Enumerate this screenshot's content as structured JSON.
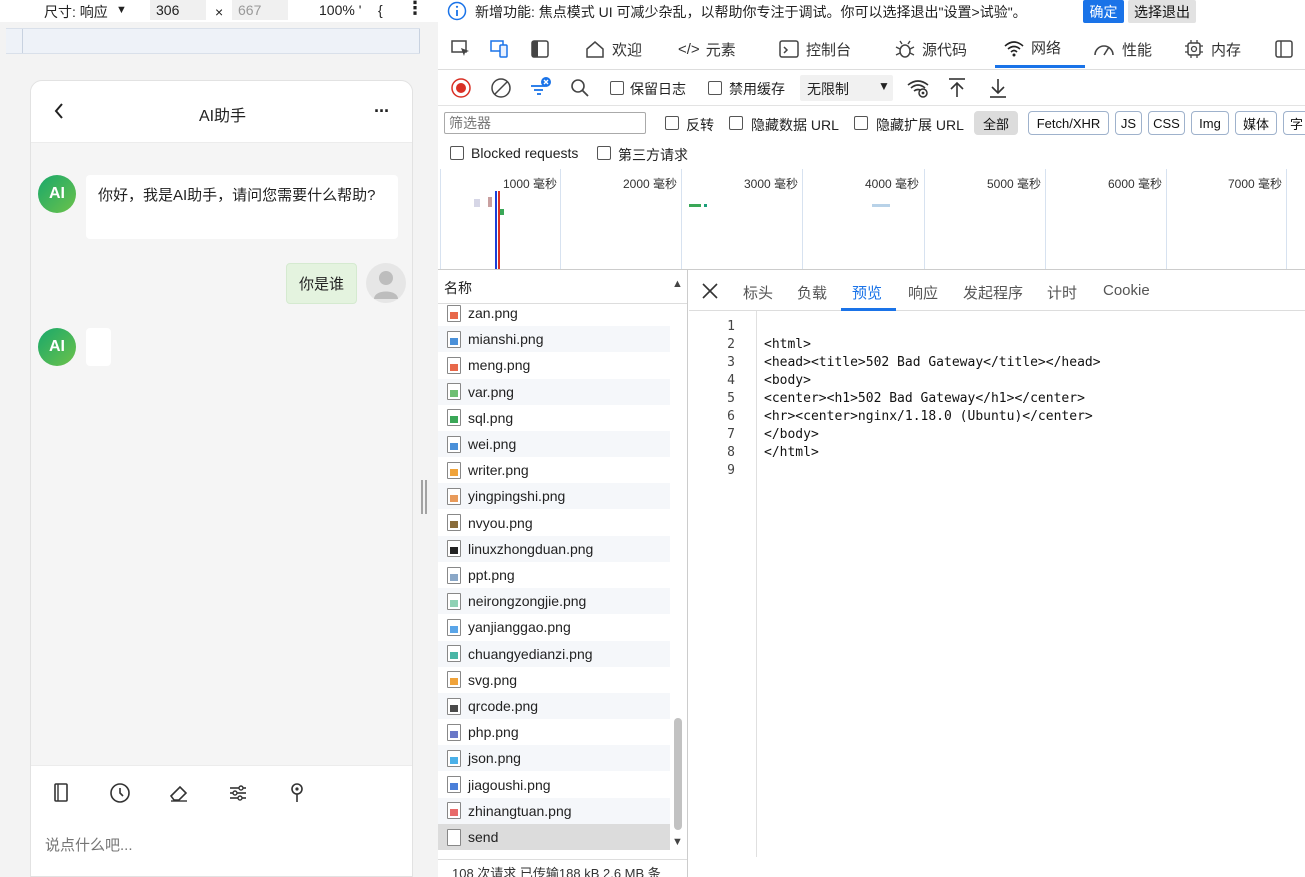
{
  "device_toolbar": {
    "dimensions_label": "尺寸: 响应",
    "width": "306",
    "height": "667",
    "zoom": "100% '",
    "extra": "{"
  },
  "chat": {
    "title": "AI助手",
    "ai_avatar": "AI",
    "ai_greeting": "你好，我是AI助手，请问您需要什么帮助?",
    "user_message": "你是谁",
    "input_placeholder": "说点什么吧..."
  },
  "banner": {
    "text": "新增功能: 焦点模式 UI 可减少杂乱，以帮助你专注于调试。你可以选择退出\"设置>试验\"。",
    "confirm": "确定",
    "optout": "选择退出"
  },
  "tabs": {
    "welcome": "欢迎",
    "elements": "元素",
    "console": "控制台",
    "sources": "源代码",
    "network": "网络",
    "performance": "性能",
    "memory": "内存"
  },
  "network_toolbar": {
    "preserve_log": "保留日志",
    "disable_cache": "禁用缓存",
    "throttle": "无限制"
  },
  "filter": {
    "placeholder": "筛选器",
    "invert": "反转",
    "hide_data_url": "隐藏数据 URL",
    "hide_ext_url": "隐藏扩展 URL",
    "types": [
      "全部",
      "Fetch/XHR",
      "JS",
      "CSS",
      "Img",
      "媒体",
      "字"
    ],
    "blocked": "Blocked requests",
    "third_party": "第三方请求"
  },
  "timeline": {
    "ticks": [
      "1000 毫秒",
      "2000 毫秒",
      "3000 毫秒",
      "4000 毫秒",
      "5000 毫秒",
      "6000 毫秒",
      "7000 毫秒"
    ]
  },
  "request_list": {
    "header": "名称",
    "items": [
      "zan.png",
      "mianshi.png",
      "meng.png",
      "var.png",
      "sql.png",
      "wei.png",
      "writer.png",
      "yingpingshi.png",
      "nvyou.png",
      "linuxzhongduan.png",
      "ppt.png",
      "neirongzongjie.png",
      "yanjianggao.png",
      "chuangyedianzi.png",
      "svg.png",
      "qrcode.png",
      "php.png",
      "json.png",
      "jiagoushi.png",
      "zhinangtuan.png",
      "send"
    ],
    "icon_colors": [
      "#e8684a",
      "#4a90d9",
      "#e8684a",
      "#6fbf73",
      "#3aa757",
      "#4a90d9",
      "#f0a33a",
      "#e89a5a",
      "#8a6d3b",
      "#222222",
      "#8aa7c7",
      "#8fd1b4",
      "#5aa5e8",
      "#49b6a6",
      "#f0a33a",
      "#4a4a4a",
      "#6a78c8",
      "#4ab0e8",
      "#4a7fd9",
      "#e86a6a",
      "#ffffff"
    ],
    "status": "108 次请求  已传输188 kB  2.6 MB 条"
  },
  "preview": {
    "tabs": [
      "标头",
      "负载",
      "预览",
      "响应",
      "发起程序",
      "计时",
      "Cookie"
    ],
    "lines": [
      "",
      "<html>",
      "<head><title>502 Bad Gateway</title></head>",
      "<body>",
      "<center><h1>502 Bad Gateway</h1></center>",
      "<hr><center>nginx/1.18.0 (Ubuntu)</center>",
      "</body>",
      "</html>",
      ""
    ]
  }
}
